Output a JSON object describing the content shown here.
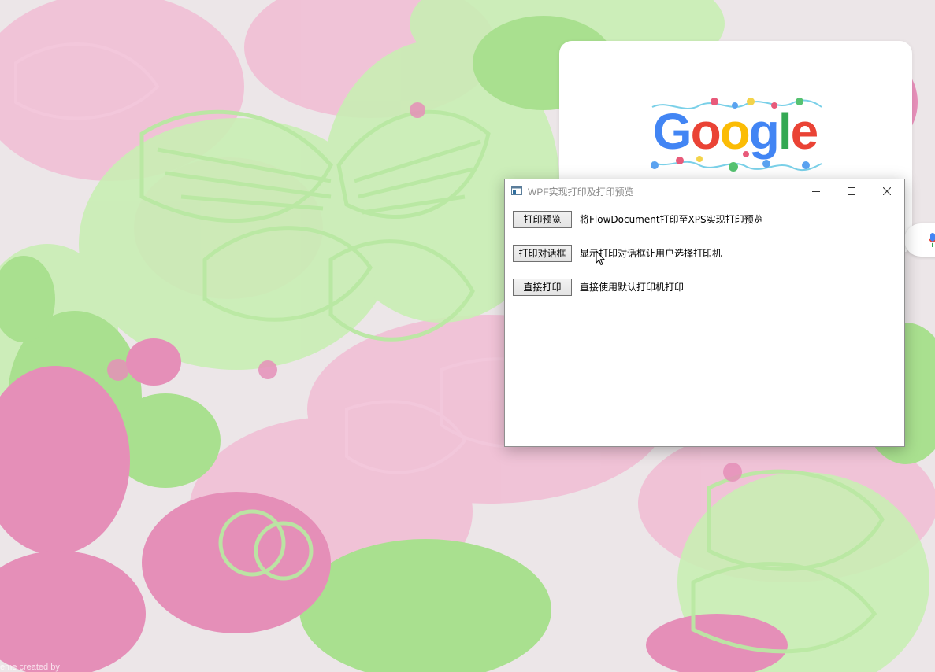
{
  "desktop": {
    "wallpaper_colors": {
      "pink": "#e58fb8",
      "light_pink": "#f1bcd3",
      "green": "#a9e08f",
      "light_green": "#c9eeb4",
      "base": "#ece6e8"
    },
    "watermark": "eme created by"
  },
  "browser": {
    "logo_text": "Google",
    "logo_colors": [
      "#4285f4",
      "#ea4335",
      "#fbbc05",
      "#4285f4",
      "#34a853",
      "#ea4335"
    ],
    "mic_icon": "microphone-icon"
  },
  "window": {
    "title": "WPF实现打印及打印预览",
    "icon": "app-window-icon",
    "controls": {
      "minimize": "minimize-icon",
      "maximize": "maximize-icon",
      "close": "close-icon"
    },
    "rows": [
      {
        "button_label": "打印预览",
        "description": "将FlowDocument打印至XPS实现打印预览"
      },
      {
        "button_label": "打印对话框",
        "description": "显示打印对话框让用户选择打印机"
      },
      {
        "button_label": "直接打印",
        "description": "直接使用默认打印机打印"
      }
    ]
  }
}
